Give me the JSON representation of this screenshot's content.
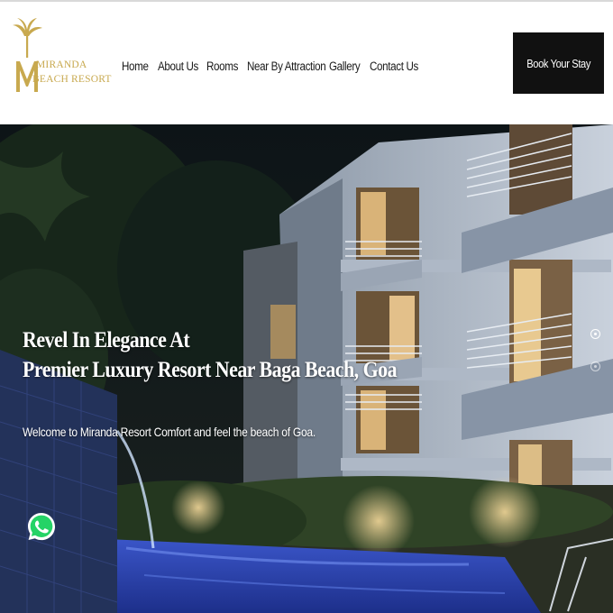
{
  "brand": {
    "line1": "MIRANDA",
    "line2": "BEACH RESORT",
    "logo_icon": "palm-tree-m-icon",
    "gold": "#c8a94f"
  },
  "nav": {
    "items": [
      {
        "label": "Home"
      },
      {
        "label": "About Us"
      },
      {
        "label": "Rooms"
      },
      {
        "label": "Near By Attraction"
      },
      {
        "label": "Gallery"
      },
      {
        "label": "Contact Us"
      }
    ]
  },
  "cta": {
    "label": "Book Your Stay",
    "color": "#111111"
  },
  "hero": {
    "title_line1": "Revel In Elegance At",
    "title_line2": "Premier Luxury Resort Near Baga Beach, Goa",
    "subtitle": "Welcome to Miranda Resort Comfort and feel the beach of Goa.",
    "slides": {
      "count": 2,
      "active": 1
    }
  },
  "floating": {
    "whatsapp_icon": "whatsapp-icon",
    "whatsapp_color": "#25d366"
  }
}
